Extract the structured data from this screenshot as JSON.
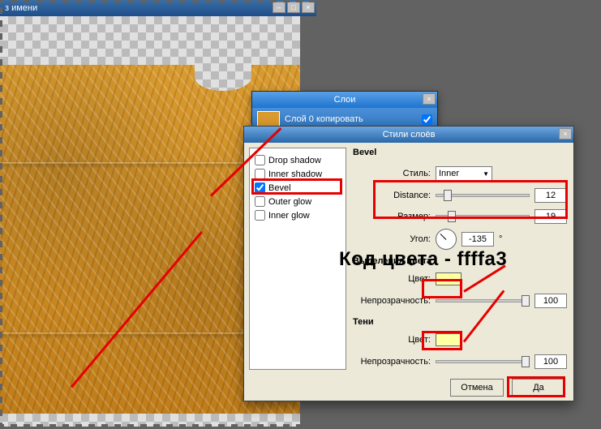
{
  "document": {
    "title_fragment": "з имени"
  },
  "layers_panel": {
    "title": "Слои",
    "layer_label": "Слой 0 копировать",
    "layer_visible": true
  },
  "styles_dialog": {
    "title": "Стили слоёв",
    "effects": [
      {
        "label": "Drop shadow",
        "checked": false
      },
      {
        "label": "Inner shadow",
        "checked": false
      },
      {
        "label": "Bevel",
        "checked": true
      },
      {
        "label": "Outer glow",
        "checked": false
      },
      {
        "label": "Inner glow",
        "checked": false
      }
    ],
    "panel_heading": "Bevel",
    "style_label": "Стиль:",
    "style_value": "Inner",
    "distance_label": "Distance:",
    "distance_value": "12",
    "size_label": "Размер:",
    "size_value": "19",
    "angle_label": "Угол:",
    "angle_value": "-135",
    "angle_suffix": "°",
    "highlight_section": "Выделения цвета",
    "color_label": "Цвет:",
    "highlight_color": "#ffffa3",
    "highlight_opacity_label": "Непрозрачность:",
    "highlight_opacity_value": "100",
    "shadow_section": "Тени",
    "shadow_color": "#ffffa3",
    "shadow_opacity_label": "Непрозрачность:",
    "shadow_opacity_value": "100",
    "cancel_label": "Отмена",
    "ok_label": "Да"
  },
  "annotation": {
    "text": "Код цвета - ffffa3"
  }
}
